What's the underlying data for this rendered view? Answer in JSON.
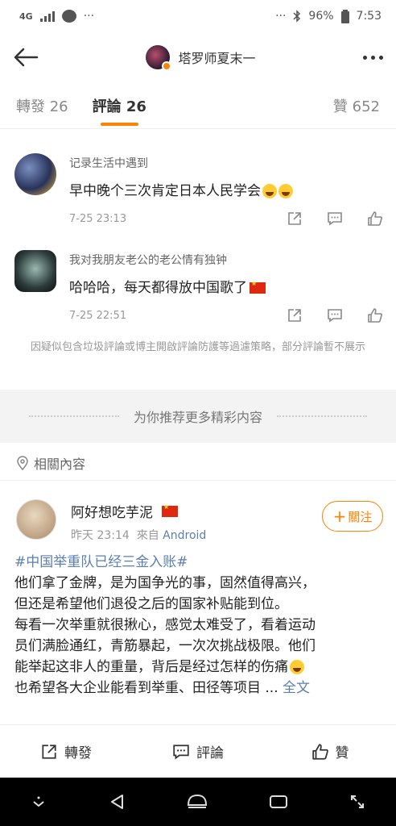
{
  "status_bar": {
    "network": "4G",
    "dots_left": "···",
    "dots_right": "···",
    "battery": "96%",
    "time": "7:53"
  },
  "nav": {
    "title": "塔罗师夏末一"
  },
  "tabs": [
    {
      "label": "轉發 26"
    },
    {
      "label": "評論 26"
    },
    {
      "label": "贊 652"
    }
  ],
  "comments": [
    {
      "name": "记录生活中遇到",
      "text": "早中晚个三次肯定日本人民学会",
      "time": "7-25 23:13"
    },
    {
      "name": "我对我朋友老公的老公情有独钟",
      "text": "哈哈哈，每天都得放中国歌了",
      "time": "7-25 22:51"
    }
  ],
  "notice": "因疑似包含垃圾評論或博主開啟評論防護等過濾策略，部分評論暫不展示",
  "recommend_label": "为你推荐更多精彩内容",
  "related_label": "相關內容",
  "post": {
    "author": "阿好想吃芋泥",
    "time": "昨天 23:14",
    "from_label": "來自",
    "source": "Android",
    "follow_label": "關注",
    "hashtag": "#中国举重队已经三金入账#",
    "lines": [
      "他们拿了金牌，是为国争光的事，固然值得高兴，",
      "但还是希望他们退役之后的国家补贴能到位。",
      "每看一次举重就很揪心，感觉太难受了，看着运动",
      "员们满脸通红，青筋暴起，一次次挑战极限。他们",
      "能举起这非人的重量，背后是经过怎样的伤痛"
    ],
    "last_line": "也希望各大企业能看到举重、田径等项目 ...",
    "full_text_label": "全文"
  },
  "actions": {
    "repost": "轉發",
    "comment": "評論",
    "like": "贊"
  },
  "colors": {
    "accent": "#ff8200",
    "link": "#5b7fb0"
  }
}
